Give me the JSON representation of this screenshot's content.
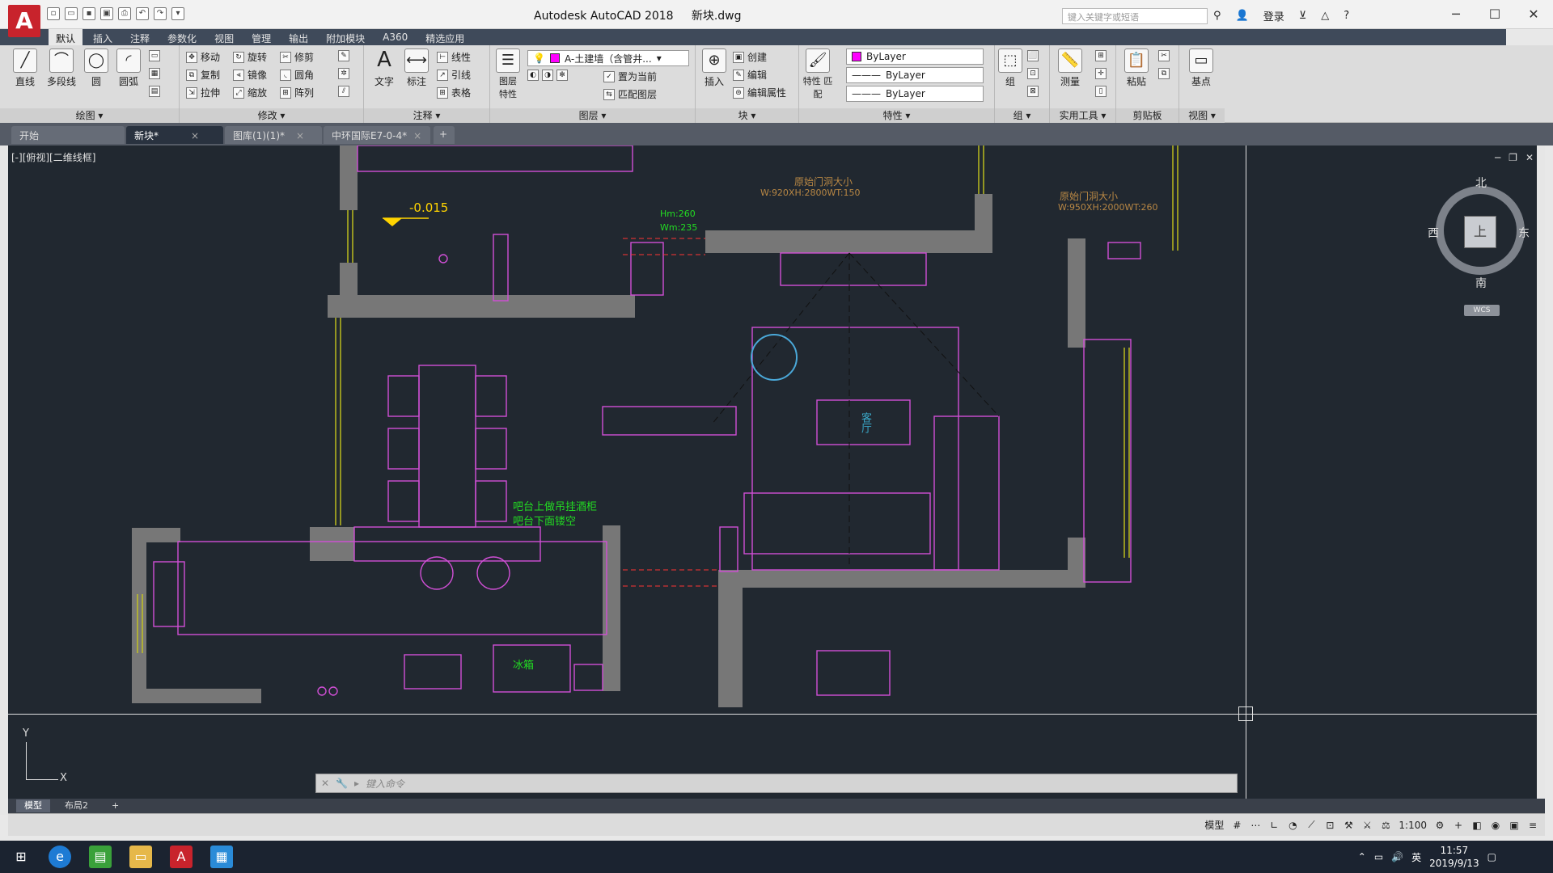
{
  "app": {
    "logo": "A",
    "title": "Autodesk AutoCAD 2018",
    "file": "新块.dwg",
    "search_placeholder": "键入关键字或短语",
    "signin": "登录",
    "help": "?"
  },
  "window_buttons": {
    "minimize": "─",
    "maximize": "☐",
    "close": "✕"
  },
  "ribbon_tabs": [
    "默认",
    "插入",
    "注释",
    "参数化",
    "视图",
    "管理",
    "输出",
    "附加模块",
    "A360",
    "精选应用"
  ],
  "groups": {
    "draw": {
      "label": "绘图 ▾",
      "line": "直线",
      "polyline": "多段线",
      "circle": "圆",
      "arc": "圆弧"
    },
    "modify": {
      "label": "修改 ▾",
      "move": "移动",
      "rotate": "旋转",
      "trim": "修剪",
      "copy": "复制",
      "mirror": "镜像",
      "fillet": "圆角",
      "stretch": "拉伸",
      "scale": "缩放",
      "array": "阵列"
    },
    "annotation": {
      "label": "注释 ▾",
      "text": "文字",
      "dimension": "标注",
      "linear": "线性",
      "leader": "引线",
      "table": "表格"
    },
    "layers": {
      "label": "图层 ▾",
      "layer_props": "图层\n特性",
      "current_layer": "A-土建墙（含管井...",
      "set_current": "置为当前",
      "match_layer": "匹配图层"
    },
    "block": {
      "label": "块 ▾",
      "insert": "插入",
      "create": "创建",
      "edit": "编辑",
      "edit_attr": "编辑属性"
    },
    "properties": {
      "label": "特性 ▾",
      "match": "特性\n匹配",
      "color": "ByLayer",
      "linetype": "ByLayer",
      "lineweight": "ByLayer"
    },
    "group": {
      "label": "组 ▾",
      "group": "组"
    },
    "utilities": {
      "label": "实用工具 ▾",
      "measure": "测量"
    },
    "clipboard": {
      "label": "剪贴板",
      "paste": "粘贴"
    },
    "view": {
      "label": "视图 ▾",
      "base": "基点"
    }
  },
  "doc_tabs": [
    {
      "label": "开始"
    },
    {
      "label": "新块*"
    },
    {
      "label": "图库(1)(1)*"
    },
    {
      "label": "中环国际E7-0-4*"
    }
  ],
  "viewport": {
    "label": "[-][俯视][二维线框]",
    "compass": {
      "n": "北",
      "s": "南",
      "e": "东",
      "w": "西",
      "center": "上",
      "wcs": "WCS"
    }
  },
  "drawing": {
    "elevation": "-0.015",
    "door_note_1": "原始门洞大小",
    "door_dims_1": "W:920XH:2800WT:150",
    "door_note_2": "原始门洞大小",
    "door_dims_2": "W:950XH:2000WT:260",
    "hm": "Hm:260",
    "wm": "Wm:235",
    "bar_note_1": "吧台上做吊挂酒柜",
    "bar_note_2": "吧台下面镂空",
    "fridge": "冰箱",
    "living": "客厅"
  },
  "command": {
    "placeholder": "键入命令"
  },
  "layout_tabs": [
    "模型",
    "布局2",
    "+"
  ],
  "status": {
    "model": "模型",
    "scale": "1:100"
  },
  "taskbar": {
    "time": "11:57",
    "date": "2019/9/13",
    "ime": "英"
  }
}
